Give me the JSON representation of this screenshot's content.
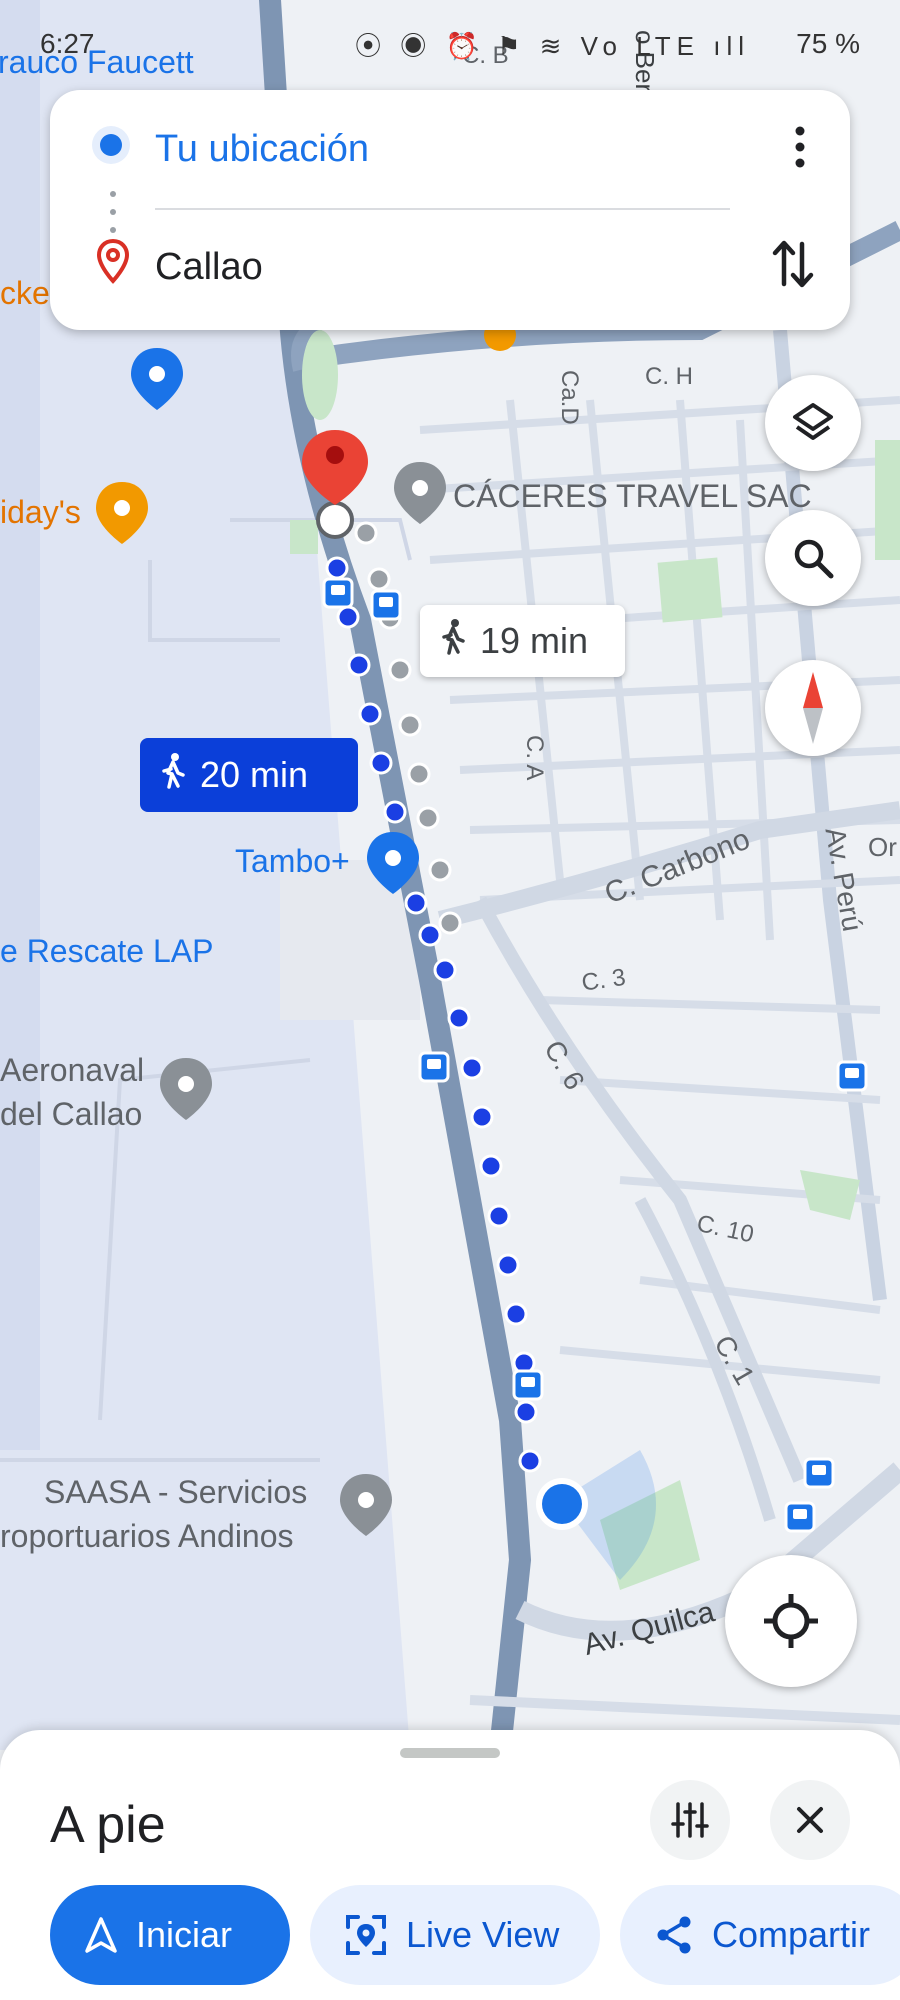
{
  "status_bar": {
    "time": "6:27",
    "battery": "75 %",
    "icons": "⦿ ◉ ⏰ ⚑ ≋ Vo LTE ıll"
  },
  "search_card": {
    "origin": "Tu ubicación",
    "destination": "Callao"
  },
  "route_labels": {
    "alt_route": "19 min",
    "main_route": "20 min"
  },
  "map_labels": {
    "faucett": "rauco Faucett",
    "c_b": "C. B",
    "bert": "o Bert",
    "icke": "cke",
    "idays": "iday's",
    "caceres": "CÁCERES TRAVEL SAC",
    "ca_d": "Ca.D",
    "c_h": "C. H",
    "c_a": "C. A",
    "tambo": "Tambo+",
    "carbono": "C. Carbono",
    "av_peru": "Av. Perú",
    "c_3": "C. 3",
    "c_6": "C. 6",
    "rescate": "e Rescate LAP",
    "aeronaval_1": "Aeronaval",
    "aeronaval_2": "del Callao",
    "c_10": "C. 10",
    "c_1": "C. 1",
    "saasa_1": "SAASA - Servicios",
    "saasa_2": "roportuarios Andinos",
    "quilca": "Av. Quilca",
    "or": "Or"
  },
  "bottom_sheet": {
    "mode": "A pie",
    "start": "Iniciar",
    "live_view": "Live View",
    "share": "Compartir"
  },
  "colors": {
    "accent": "#1a73e8",
    "route_blue": "#1b3fe3",
    "route_gray": "#9aa0a6",
    "road": "#7e95b3",
    "pin_red": "#ea4335"
  }
}
